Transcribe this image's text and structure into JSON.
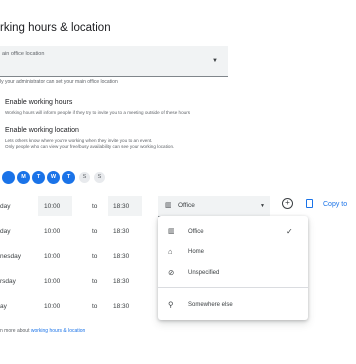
{
  "header": {
    "title": "rking hours & location"
  },
  "main_office": {
    "label": "ain office location",
    "helper": "ly your administrator can set your main office location"
  },
  "enable_working_hours": {
    "label": "Enable working hours",
    "desc": "Working hours will inform people if they try to invite you to a meeting outside of these hours"
  },
  "enable_working_location": {
    "label": "Enable working location",
    "desc1": "Lets others know where you're working when they invite you to an event.",
    "desc2": "Only people who can view your free/busy availability can see your working location."
  },
  "days": [
    {
      "label": "",
      "selected": true
    },
    {
      "label": "M",
      "selected": true
    },
    {
      "label": "T",
      "selected": true
    },
    {
      "label": "W",
      "selected": true
    },
    {
      "label": "T",
      "selected": true
    },
    {
      "label": "F",
      "selected": true
    },
    {
      "label": "S",
      "selected": false
    },
    {
      "label": "S",
      "selected": false
    }
  ],
  "schedule": [
    {
      "day": "day",
      "start": "10:00",
      "sep": "to",
      "end": "18:30"
    },
    {
      "day": "day",
      "start": "10:00",
      "sep": "to",
      "end": "18:30"
    },
    {
      "day": "nesday",
      "start": "10:00",
      "sep": "to",
      "end": "18:30"
    },
    {
      "day": "rsday",
      "start": "10:00",
      "sep": "to",
      "end": "18:30"
    },
    {
      "day": "ay",
      "start": "10:00",
      "sep": "to",
      "end": "18:30"
    }
  ],
  "location_select": {
    "value": "Office"
  },
  "copy_label": "Copy to",
  "menu": {
    "items": [
      {
        "label": "Office",
        "icon": "office-building-icon",
        "checked": true
      },
      {
        "label": "Home",
        "icon": "home-icon",
        "checked": false
      },
      {
        "label": "Unspecified",
        "icon": "location-off-icon",
        "checked": false
      },
      {
        "label": "Somewhere else",
        "icon": "map-pin-icon",
        "checked": false
      }
    ]
  },
  "footer": {
    "prefix": "n more about ",
    "link": "working hours & location"
  },
  "colors": {
    "accent": "#1a73e8",
    "field_bg": "#f1f3f4"
  }
}
